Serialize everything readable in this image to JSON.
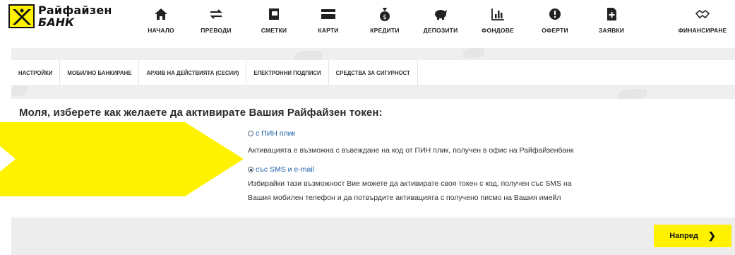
{
  "brand": {
    "line1": "Райфайзен",
    "line2": "БАНК"
  },
  "nav": [
    {
      "label": "НАЧАЛО",
      "icon": "home-icon"
    },
    {
      "label": "ПРЕВОДИ",
      "icon": "transfer-icon"
    },
    {
      "label": "СМЕТКИ",
      "icon": "account-icon"
    },
    {
      "label": "КАРТИ",
      "icon": "card-icon"
    },
    {
      "label": "КРЕДИТИ",
      "icon": "money-bag-icon"
    },
    {
      "label": "ДЕПОЗИТИ",
      "icon": "piggy-bank-icon"
    },
    {
      "label": "ФОНДОВЕ",
      "icon": "bar-chart-icon"
    },
    {
      "label": "ОФЕРТИ",
      "icon": "offer-badge-icon"
    },
    {
      "label": "ЗАЯВКИ",
      "icon": "add-document-icon"
    },
    {
      "label": "ФИНАНСИРАНЕ",
      "icon": "handshake-icon"
    }
  ],
  "tabs": [
    "НАСТРОЙКИ",
    "МОБИЛНО БАНКИРАНЕ",
    "АРХИВ НА ДЕЙСТВИЯТА (СЕСИИ)",
    "ЕЛЕКТРОННИ ПОДПИСИ",
    "СРЕДСТВА ЗА СИГУРНОСТ"
  ],
  "main": {
    "title": "Моля, изберете как желаете да активирате Вашия Райфайзен токен:",
    "options": [
      {
        "label": "с ПИН плик",
        "checked": false,
        "description": [
          "Активацията е възможна с въвеждане на код от ПИН плик, получен в офис на Райфайзенбанк"
        ]
      },
      {
        "label": "със SMS и e-mail",
        "checked": true,
        "description": [
          "Избирайки тази възможност Вие можете да активирате своя токен с код, получен със SMS на",
          "Вашия мобилен телефон и да потвърдите активацията с получено писмо на Вашия имейл"
        ]
      }
    ]
  },
  "footer": {
    "next_label": "Напред",
    "next_icon": "chevron-right-icon"
  },
  "colors": {
    "brand_yellow": "#fff200",
    "link_blue": "#1e5fa8",
    "text_dark": "#2b2b2b",
    "backdrop_gray": "#efefef"
  }
}
